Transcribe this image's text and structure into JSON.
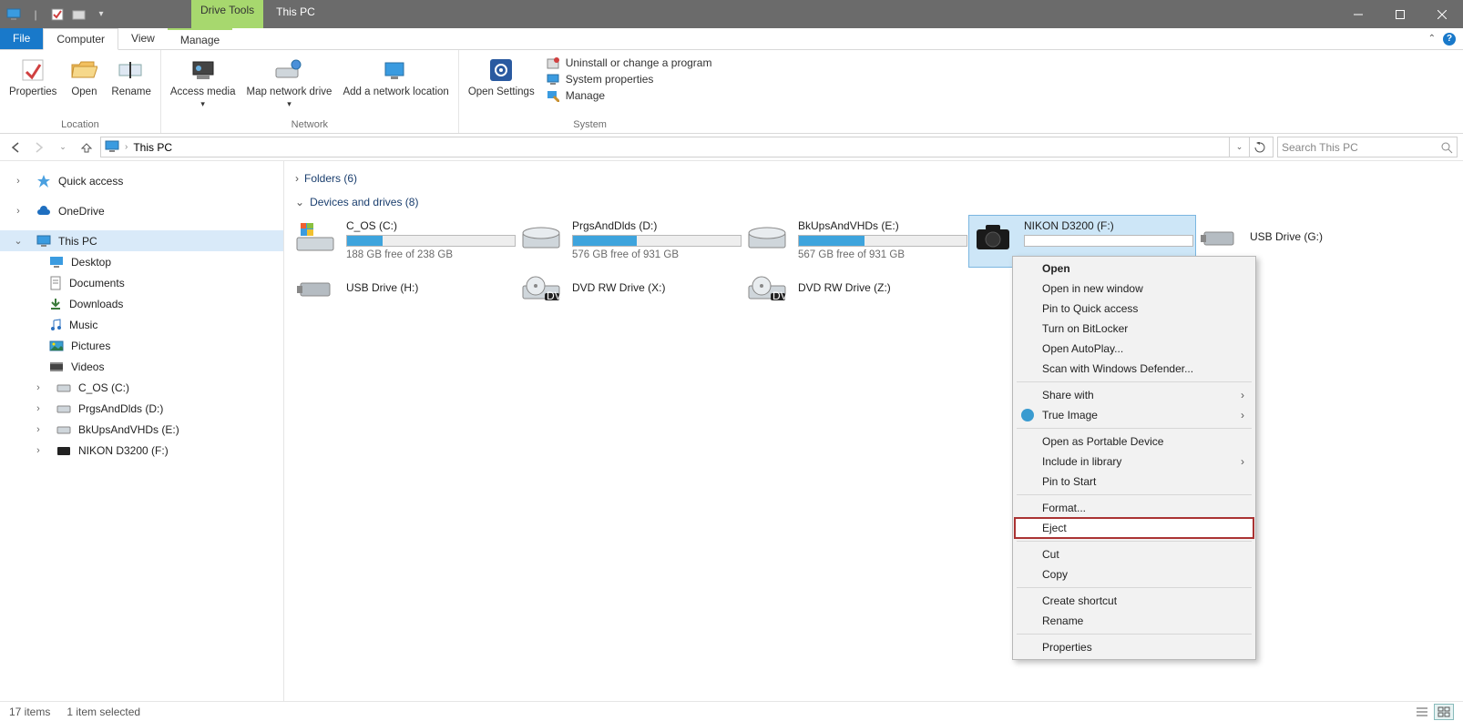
{
  "titlebar": {
    "drive_tools": "Drive Tools",
    "title": "This PC"
  },
  "tabs": {
    "file": "File",
    "computer": "Computer",
    "view": "View",
    "manage": "Manage"
  },
  "ribbon": {
    "location": {
      "label": "Location",
      "properties": "Properties",
      "open": "Open",
      "rename": "Rename"
    },
    "network": {
      "label": "Network",
      "access_media": "Access media",
      "map_drive": "Map network drive",
      "add_loc": "Add a network location"
    },
    "system": {
      "label": "System",
      "open_settings": "Open Settings",
      "uninstall": "Uninstall or change a program",
      "sys_props": "System properties",
      "manage": "Manage"
    }
  },
  "address": {
    "path": "This PC",
    "search_placeholder": "Search This PC"
  },
  "nav": {
    "quick_access": "Quick access",
    "onedrive": "OneDrive",
    "this_pc": "This PC",
    "desktop": "Desktop",
    "documents": "Documents",
    "downloads": "Downloads",
    "music": "Music",
    "pictures": "Pictures",
    "videos": "Videos",
    "c_os": "C_OS (C:)",
    "prgs": "PrgsAndDlds (D:)",
    "bkups": "BkUpsAndVHDs (E:)",
    "nikon": "NIKON D3200 (F:)"
  },
  "sections": {
    "folders": "Folders (6)",
    "devices": "Devices and drives (8)"
  },
  "drives": {
    "c": {
      "name": "C_OS (C:)",
      "free": "188 GB free of 238 GB",
      "pct": 21
    },
    "d": {
      "name": "PrgsAndDlds (D:)",
      "free": "576 GB free of 931 GB",
      "pct": 38
    },
    "e": {
      "name": "BkUpsAndVHDs (E:)",
      "free": "567 GB free of 931 GB",
      "pct": 39
    },
    "f": {
      "name": "NIKON D3200 (F:)"
    },
    "g": {
      "name": "USB Drive (G:)"
    },
    "h": {
      "name": "USB Drive (H:)"
    },
    "x": {
      "name": "DVD RW Drive (X:)"
    },
    "z": {
      "name": "DVD RW Drive (Z:)"
    }
  },
  "context_menu": {
    "open": "Open",
    "open_new": "Open in new window",
    "pin_qa": "Pin to Quick access",
    "bitlocker": "Turn on BitLocker",
    "autoplay": "Open AutoPlay...",
    "defender": "Scan with Windows Defender...",
    "share": "Share with",
    "true_image": "True Image",
    "portable": "Open as Portable Device",
    "include_lib": "Include in library",
    "pin_start": "Pin to Start",
    "format": "Format...",
    "eject": "Eject",
    "cut": "Cut",
    "copy": "Copy",
    "shortcut": "Create shortcut",
    "rename": "Rename",
    "properties": "Properties"
  },
  "status": {
    "items": "17 items",
    "selected": "1 item selected"
  }
}
